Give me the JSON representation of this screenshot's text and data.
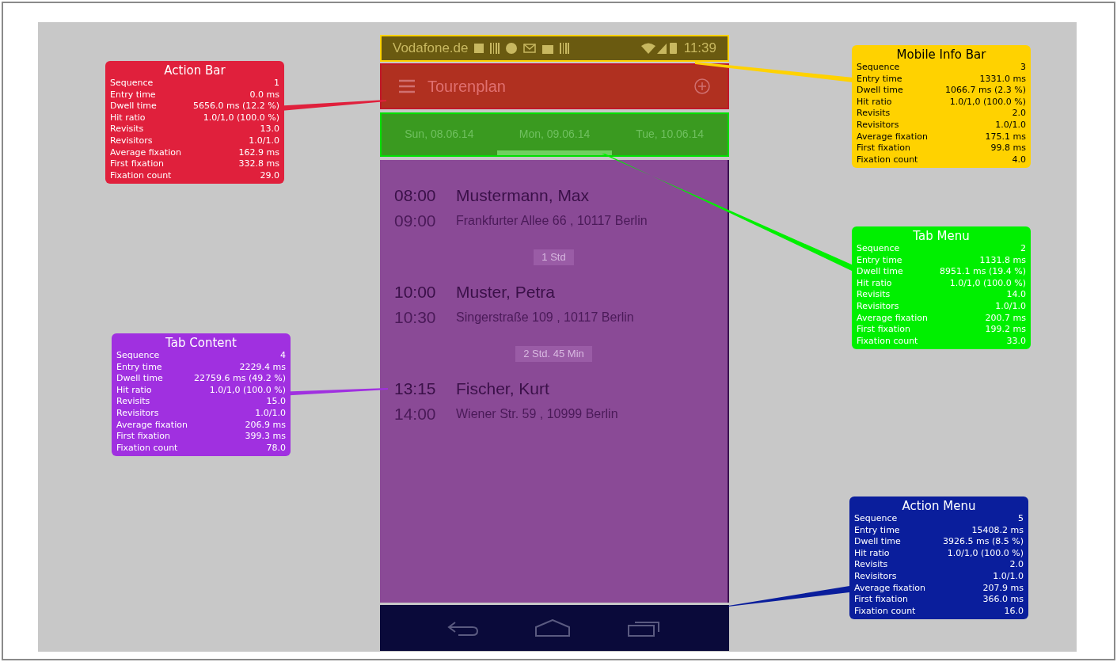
{
  "phone": {
    "status_bar": {
      "carrier": "Vodafone.de",
      "time": "11:39"
    },
    "action_bar": {
      "title": "Tourenplan"
    },
    "tabs": [
      {
        "label": "Sun, 08.06.14",
        "selected": false
      },
      {
        "label": "Mon, 09.06.14",
        "selected": true
      },
      {
        "label": "Tue, 10.06.14",
        "selected": false
      }
    ],
    "schedule": [
      {
        "kind": "appointment",
        "start": "08:00",
        "end": "09:00",
        "name": "Mustermann, Max",
        "address": "Frankfurter Allee 66 , 10117 Berlin"
      },
      {
        "kind": "gap",
        "label": "1 Std"
      },
      {
        "kind": "appointment",
        "start": "10:00",
        "end": "10:30",
        "name": "Muster, Petra",
        "address": "Singerstraße 109 , 10117 Berlin"
      },
      {
        "kind": "gap",
        "label": "2 Std. 45 Min"
      },
      {
        "kind": "appointment",
        "start": "13:15",
        "end": "14:00",
        "name": "Fischer, Kurt",
        "address": "Wiener Str. 59 , 10999 Berlin"
      }
    ]
  },
  "areas": [
    {
      "title": "Action Bar",
      "color": "#e0203c",
      "metrics": [
        [
          "Sequence",
          "1"
        ],
        [
          "Entry time",
          "0.0 ms"
        ],
        [
          "Dwell time",
          "5656.0 ms (12.2 %)"
        ],
        [
          "Hit ratio",
          "1.0/1,0 (100.0 %)"
        ],
        [
          "Revisits",
          "13.0"
        ],
        [
          "Revisitors",
          "1.0/1.0"
        ],
        [
          "Average fixation",
          "162.9 ms"
        ],
        [
          "First fixation",
          "332.8 ms"
        ],
        [
          "Fixation count",
          "29.0"
        ]
      ]
    },
    {
      "title": "Mobile Info Bar",
      "color": "#ffd200",
      "metrics": [
        [
          "Sequence",
          "3"
        ],
        [
          "Entry time",
          "1331.0 ms"
        ],
        [
          "Dwell time",
          "1066.7 ms (2.3 %)"
        ],
        [
          "Hit ratio",
          "1.0/1,0 (100.0 %)"
        ],
        [
          "Revisits",
          "2.0"
        ],
        [
          "Revisitors",
          "1.0/1.0"
        ],
        [
          "Average fixation",
          "175.1 ms"
        ],
        [
          "First fixation",
          "99.8 ms"
        ],
        [
          "Fixation count",
          "4.0"
        ]
      ]
    },
    {
      "title": "Tab Menu",
      "color": "#00f000",
      "metrics": [
        [
          "Sequence",
          "2"
        ],
        [
          "Entry time",
          "1131.8 ms"
        ],
        [
          "Dwell time",
          "8951.1 ms (19.4 %)"
        ],
        [
          "Hit ratio",
          "1.0/1,0 (100.0 %)"
        ],
        [
          "Revisits",
          "14.0"
        ],
        [
          "Revisitors",
          "1.0/1.0"
        ],
        [
          "Average fixation",
          "200.7 ms"
        ],
        [
          "First fixation",
          "199.2 ms"
        ],
        [
          "Fixation count",
          "33.0"
        ]
      ]
    },
    {
      "title": "Tab Content",
      "color": "#a030e0",
      "metrics": [
        [
          "Sequence",
          "4"
        ],
        [
          "Entry time",
          "2229.4 ms"
        ],
        [
          "Dwell time",
          "22759.6 ms (49.2 %)"
        ],
        [
          "Hit ratio",
          "1.0/1,0 (100.0 %)"
        ],
        [
          "Revisits",
          "15.0"
        ],
        [
          "Revisitors",
          "1.0/1.0"
        ],
        [
          "Average fixation",
          "206.9 ms"
        ],
        [
          "First fixation",
          "399.3 ms"
        ],
        [
          "Fixation count",
          "78.0"
        ]
      ]
    },
    {
      "title": "Action Menu",
      "color": "#0a1e9c",
      "metrics": [
        [
          "Sequence",
          "5"
        ],
        [
          "Entry time",
          "15408.2 ms"
        ],
        [
          "Dwell time",
          "3926.5 ms (8.5 %)"
        ],
        [
          "Hit ratio",
          "1.0/1,0 (100.0 %)"
        ],
        [
          "Revisits",
          "2.0"
        ],
        [
          "Revisitors",
          "1.0/1.0"
        ],
        [
          "Average fixation",
          "207.9 ms"
        ],
        [
          "First fixation",
          "366.0 ms"
        ],
        [
          "Fixation count",
          "16.0"
        ]
      ]
    }
  ]
}
